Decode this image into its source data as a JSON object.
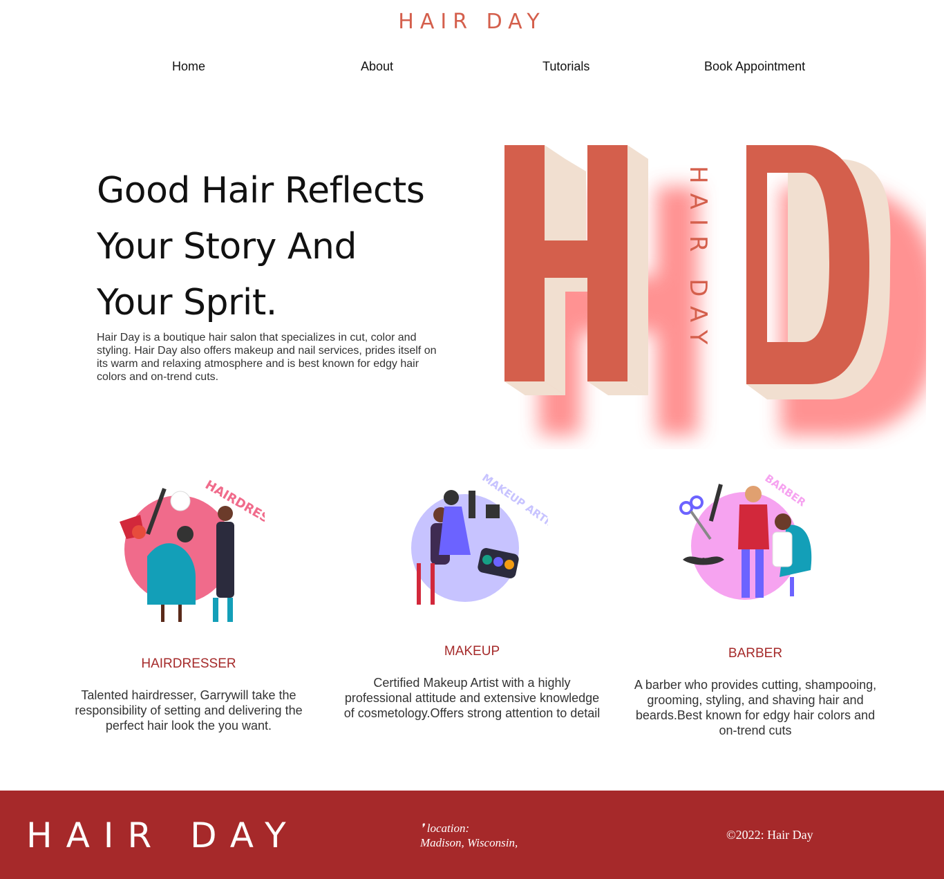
{
  "header": {
    "brand": "HAIR DAY",
    "nav": [
      {
        "label": "Home"
      },
      {
        "label": "About"
      },
      {
        "label": "Tutorials"
      },
      {
        "label": "Book Appointment"
      }
    ]
  },
  "hero": {
    "title_lines": [
      "Good Hair Reflects",
      "Your Story And",
      "Your Sprit."
    ],
    "description": "Hair Day is a boutique hair salon that specializes in cut, color and styling. Hair Day also offers makeup and nail services, prides itself on its warm and relaxing atmosphere and is best known for edgy hair colors and on-trend cuts.",
    "logo": {
      "letters": "HD",
      "vertical_text": "HAIR DAY"
    }
  },
  "services": [
    {
      "badge": "HAIRDRESSER",
      "title": "HAIRDRESSER",
      "description": "Talented hairdresser, Garrywill take the responsibility of setting and delivering the perfect hair look the you want."
    },
    {
      "badge": "MAKEUP ARTIST",
      "title": "MAKEUP",
      "description": "Certified Makeup Artist with a highly professional attitude and extensive knowledge of cosmetology.Offers strong attention to detail"
    },
    {
      "badge": "BARBER",
      "title": "BARBER",
      "description": "A barber who provides cutting, shampooing, grooming, styling, and shaving hair and beards.Best known for edgy hair colors and on-trend cuts"
    }
  ],
  "footer": {
    "brand": "HAIR DAY",
    "location_label": "location:",
    "location_value": "Madison, Wisconsin,",
    "copyright": "©2022: Hair Day"
  },
  "colors": {
    "brand": "#d45f4c",
    "accent_dark": "#a6292a",
    "cream": "#f1dfd0",
    "glow": "#ff7f7f"
  },
  "icons": [
    "location-pin-icon",
    "hairdresser-illustration",
    "makeup-artist-illustration",
    "barber-illustration"
  ]
}
